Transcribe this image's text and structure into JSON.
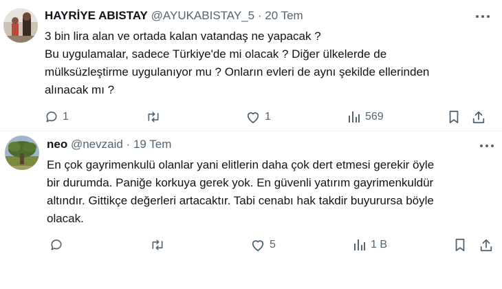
{
  "tweets": [
    {
      "author_name": "HAYRİYE ABISTAY",
      "handle": "@AYUKABISTAY_5",
      "separator": "·",
      "date": "20 Tem",
      "lines": [
        "3 bin lira alan ve ortada kalan vatandaş ne yapacak ?",
        "Bu uygulamalar, sadece Türkiye'de mi olacak ? Diğer ülkelerde de",
        "mülksüzleştirme  uygulanıyor mu ? Onların evleri de aynı şekilde ellerinden",
        "alınacak mı ?"
      ],
      "replies": "1",
      "retweets": "",
      "likes": "1",
      "views": "569"
    },
    {
      "author_name": "neo",
      "handle": "@nevzaid",
      "separator": "·",
      "date": "19 Tem",
      "lines": [
        "En çok gayrimenkulü olanlar yani elitlerin daha çok dert etmesi gerekir öyle",
        "bir durumda. Paniğe korkuya gerek yok. En güvenli yatırım gayrimenkuldür",
        "altındır. Gittikçe değerleri artacaktır. Tabi cenabı hak takdir buyurursa böyle",
        "olacak."
      ],
      "replies": "",
      "retweets": "",
      "likes": "5",
      "views": "1 B"
    }
  ],
  "colors": {
    "text": "#0f1419",
    "secondary": "#536471",
    "divider": "#eff3f4"
  },
  "icons": [
    "reply-icon",
    "retweet-icon",
    "like-icon",
    "views-icon",
    "bookmark-icon",
    "share-icon",
    "more-icon"
  ]
}
